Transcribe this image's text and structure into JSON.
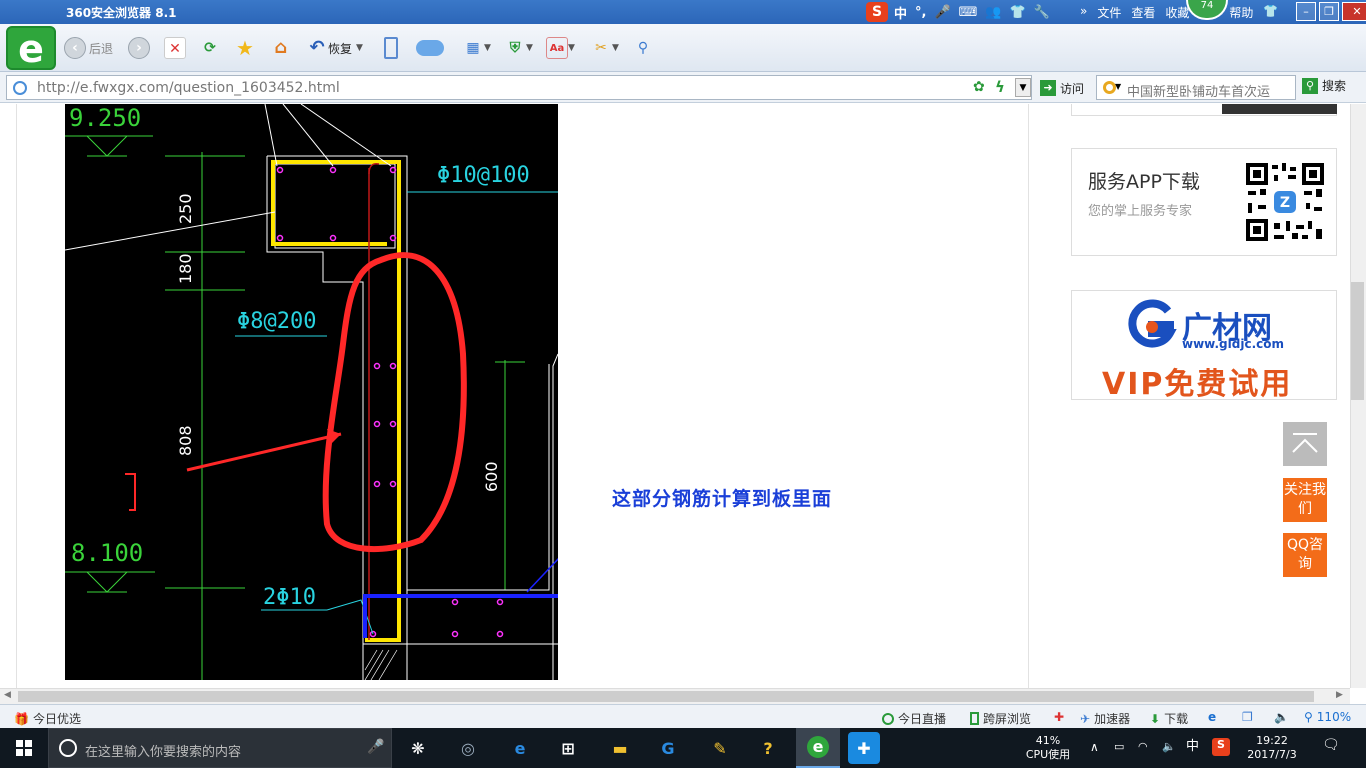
{
  "window": {
    "title": "360安全浏览器 8.1",
    "menus": [
      "文件",
      "查看",
      "收藏",
      "帮助"
    ],
    "badge": "74",
    "ime": [
      "S",
      "中",
      "°,",
      "🎤",
      "⌨",
      "👥",
      "👕",
      "🔧"
    ]
  },
  "toolbar": {
    "back_label": "后退",
    "restore_label": "恢复"
  },
  "address": {
    "url": "http://e.fwxgx.com/question_1603452.html",
    "visit_label": "访问",
    "search_placeholder": "中国新型卧铺动车首次运",
    "search_label": "搜索"
  },
  "cad": {
    "elev_top": "9.250",
    "elev_bottom": "8.100",
    "dim_250": "250",
    "dim_180": "180",
    "dim_808": "808",
    "dim_600": "600",
    "rebar_top": "Φ10@100",
    "rebar_mid": "Φ8@200",
    "rebar_bottom": "2Φ10"
  },
  "annotation": "这部分钢筋计算到板里面",
  "sidebar": {
    "app_title": "服务APP下载",
    "app_sub": "您的掌上服务专家",
    "gc_name": "广材网",
    "gc_url": "www.gldjc.com",
    "gc_vip": "VIP免费试用",
    "follow_label": "关注我们",
    "qq_label": "QQ咨询"
  },
  "statusbar": {
    "left": "今日优选",
    "live": "今日直播",
    "cross": "跨屏浏览",
    "accel": "加速器",
    "download": "下载",
    "zoom": "110%"
  },
  "taskbar": {
    "search_placeholder": "在这里输入你要搜索的内容",
    "cpu_percent": "41%",
    "cpu_label": "CPU使用",
    "ime": "中",
    "time": "19:22",
    "date": "2017/7/3"
  }
}
